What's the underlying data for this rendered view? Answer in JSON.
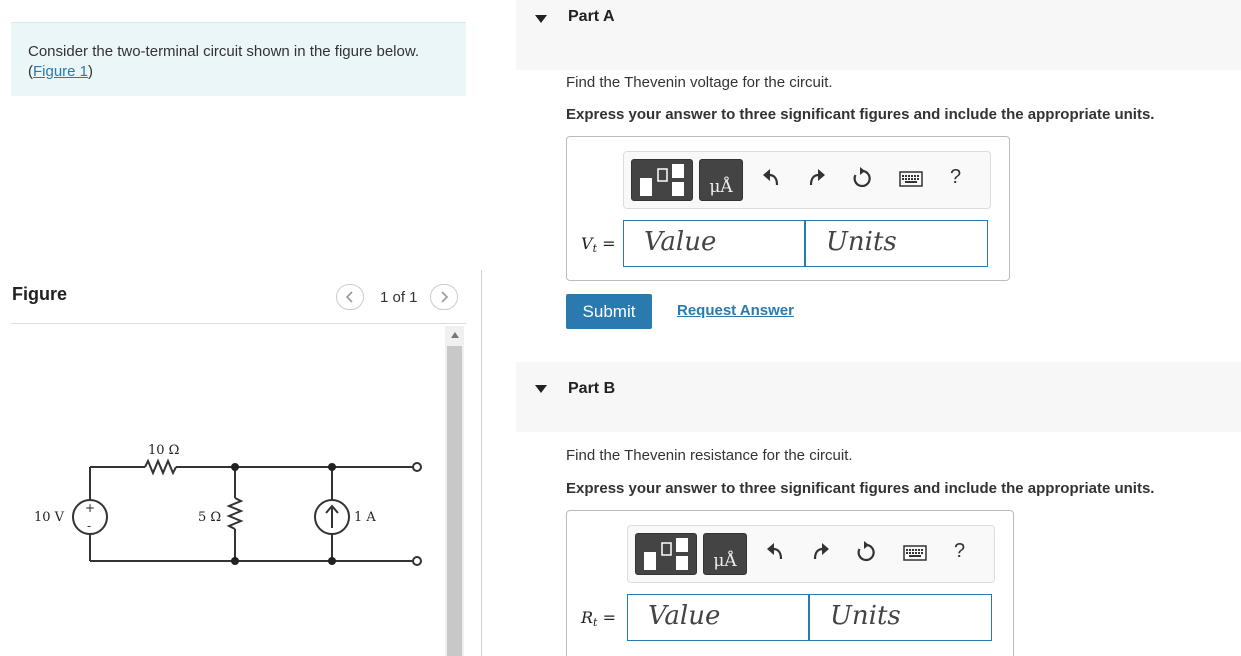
{
  "left": {
    "prompt_text": "Consider the two-terminal circuit shown in the figure below. (",
    "figure_link": "Figure 1",
    "prompt_close": ")",
    "figure_title": "Figure",
    "pager_text": "1 of 1",
    "circuit": {
      "r1_label": "10 Ω",
      "r2_label": "5 Ω",
      "source_v_label": "10 V",
      "source_i_label": "1 A",
      "plus": "+",
      "minus": "-"
    }
  },
  "parts": [
    {
      "label": "Part A",
      "question": "Find the Thevenin voltage for the circuit.",
      "instruction": "Express your answer to three significant figures and include the appropriate units.",
      "var_main": "V",
      "var_sub": "t",
      "equals": "=",
      "value_placeholder": "Value",
      "units_placeholder": "Units",
      "units_btn": "μÅ",
      "help": "?",
      "submit": "Submit",
      "request": "Request Answer"
    },
    {
      "label": "Part B",
      "question": "Find the Thevenin resistance for the circuit.",
      "instruction": "Express your answer to three significant figures and include the appropriate units.",
      "var_main": "R",
      "var_sub": "t",
      "equals": "=",
      "value_placeholder": "Value",
      "units_placeholder": "Units",
      "units_btn": "μÅ",
      "help": "?"
    }
  ]
}
